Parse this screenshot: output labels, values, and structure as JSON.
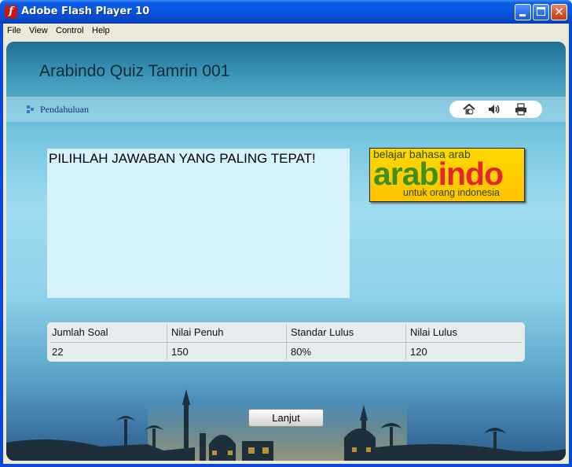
{
  "window": {
    "title": "Adobe Flash Player 10",
    "icon": "flash-player-icon",
    "controls": [
      "minimize",
      "maximize",
      "close"
    ]
  },
  "menu": [
    "File",
    "View",
    "Control",
    "Help"
  ],
  "quiz": {
    "title": "Arabindo Quiz Tamrin 001",
    "nav_label": "Pendahuluan",
    "tools": [
      "home-icon",
      "speaker-icon",
      "printer-icon"
    ],
    "question": "PILIHLAH JAWABAN YANG PALING TEPAT!",
    "logo": {
      "top": "belajar bahasa arab",
      "main_a": "arab",
      "main_b": "indo",
      "bottom": "untuk orang indonesia"
    },
    "table": {
      "headers": [
        "Jumlah Soal",
        "Nilai Penuh",
        "Standar Lulus",
        "Nilai Lulus"
      ],
      "values": [
        "22",
        "150",
        "80%",
        "120"
      ]
    },
    "button": "Lanjut"
  },
  "colors": {
    "titlebar": "#0a55e0",
    "question_box": "#d6f2fb",
    "logo_bg": "#ffd800",
    "logo_green": "#3f8f1c",
    "logo_red": "#e0262e"
  }
}
